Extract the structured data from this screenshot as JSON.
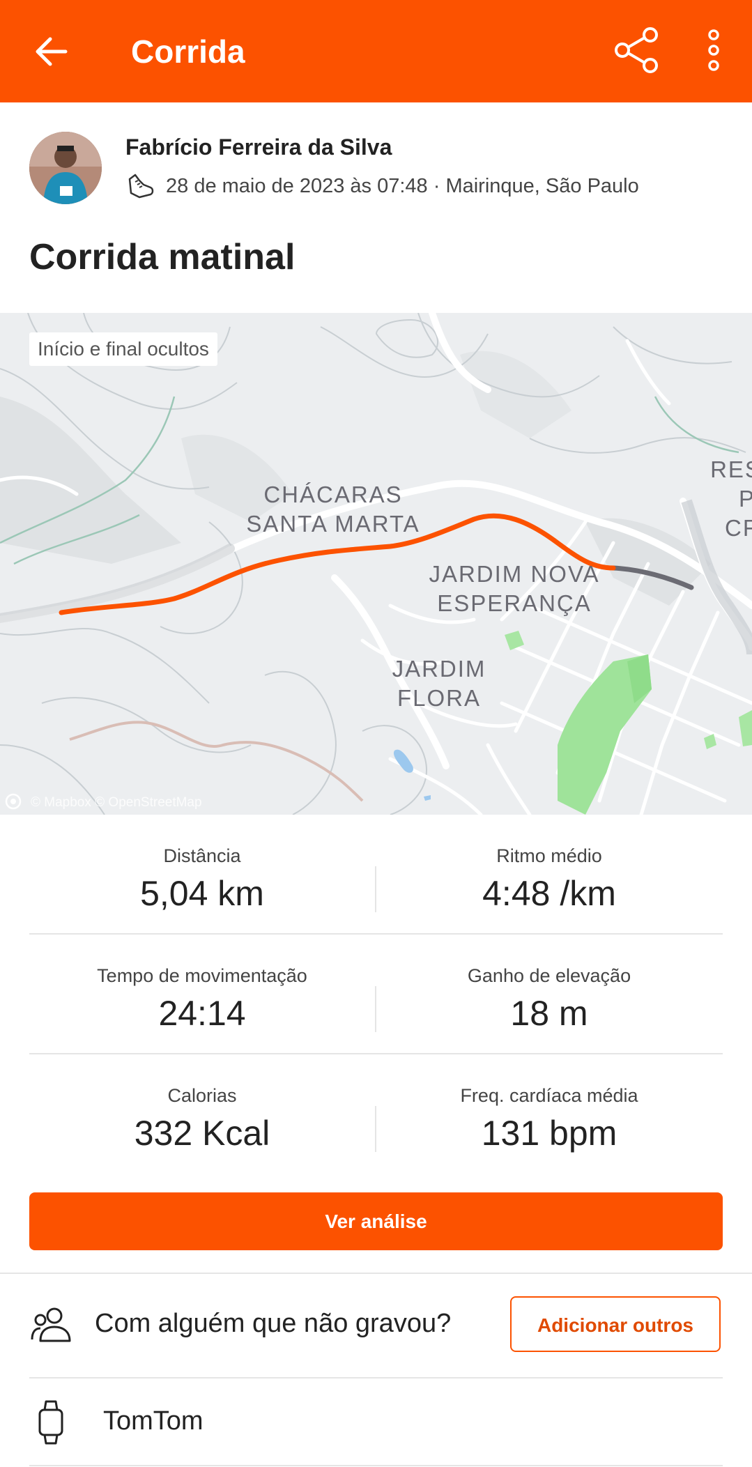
{
  "appbar": {
    "title": "Corrida",
    "back_icon": "arrow-left-icon",
    "share_icon": "share-icon",
    "more_icon": "more-vertical-icon",
    "color": "#fc5200"
  },
  "athlete": {
    "name": "Fabrício Ferreira da Silva",
    "meta": "28 de maio de 2023 às 07:48 · Mairinque, São Paulo",
    "sport_icon": "running-shoe-icon"
  },
  "activity": {
    "title": "Corrida matinal"
  },
  "map": {
    "privacy_badge": "Início e final ocultos",
    "attribution": "© Mapbox © OpenStreetMap",
    "labels": {
      "chacaras_1": "CHÁCARAS",
      "chacaras_2": "SANTA MARTA",
      "jnova_1": "JARDIM NOVA",
      "jnova_2": "ESPERANÇA",
      "jflora_1": "JARDIM",
      "jflora_2": "FLORA",
      "edge_1": "RES",
      "edge_2": "P",
      "edge_3": "CF"
    },
    "route_color": "#fc5200",
    "hidden_route_color": "#6b6b73"
  },
  "stats": [
    {
      "left_label": "Distância",
      "left_value": "5,04 km",
      "right_label": "Ritmo médio",
      "right_value": "4:48 /km"
    },
    {
      "left_label": "Tempo de movimentação",
      "left_value": "24:14",
      "right_label": "Ganho de elevação",
      "right_value": "18 m"
    },
    {
      "left_label": "Calorias",
      "left_value": "332 Kcal",
      "right_label": "Freq. cardíaca média",
      "right_value": "131 bpm"
    }
  ],
  "analysis_button": "Ver análise",
  "together": {
    "question": "Com alguém que não gravou?",
    "add_button": "Adicionar outros",
    "icon": "people-icon"
  },
  "device": {
    "name": "TomTom",
    "icon": "watch-icon"
  }
}
